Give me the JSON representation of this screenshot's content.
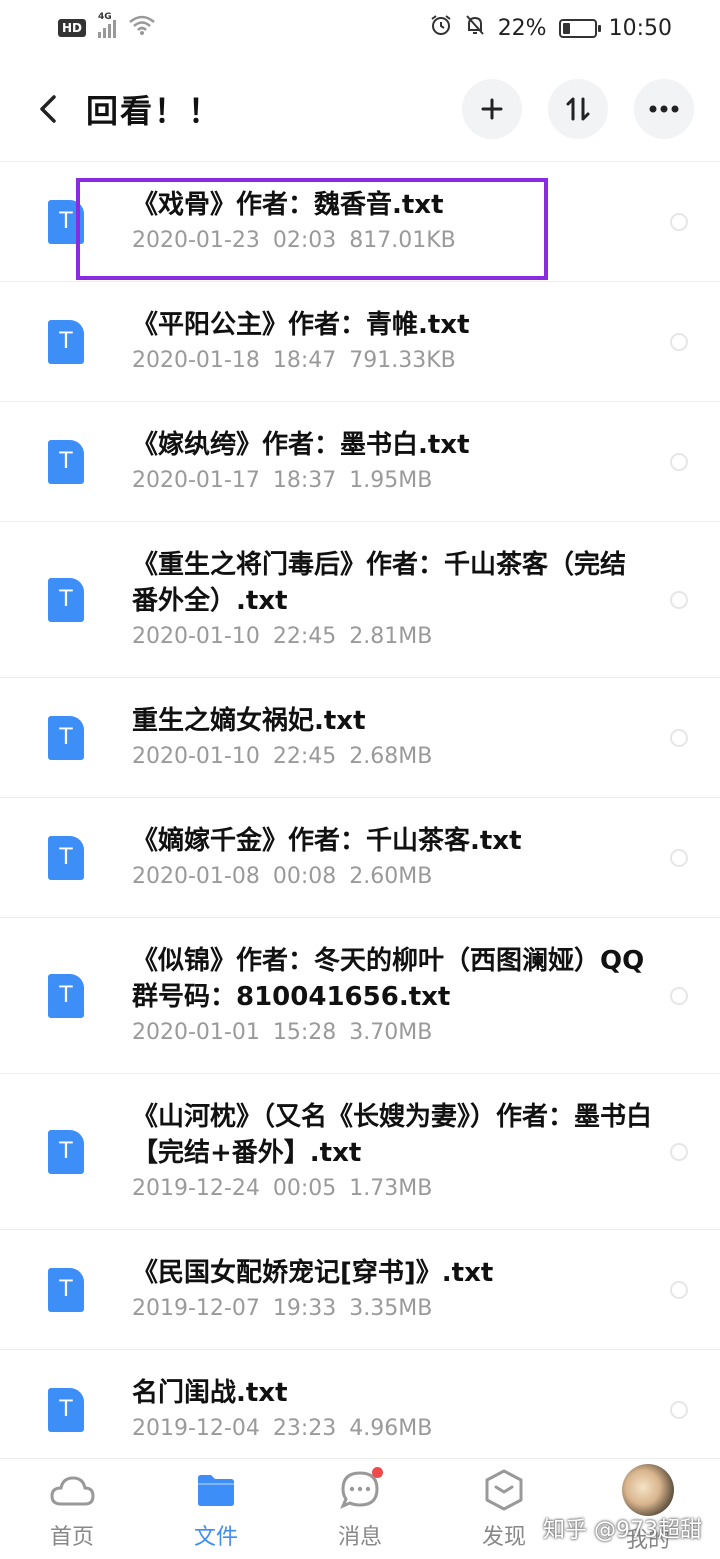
{
  "status_bar": {
    "hd": "HD",
    "network": "4G",
    "battery": "22%",
    "time": "10:50"
  },
  "header": {
    "title": "回看！！"
  },
  "icons": {
    "back": "chevron-left-icon",
    "add": "plus-icon",
    "sort": "sort-icon",
    "more": "more-icon"
  },
  "files": [
    {
      "name": "《戏骨》作者：魏香音.txt",
      "date": "2020-01-23",
      "time": "02:03",
      "size": "817.01KB"
    },
    {
      "name": "《平阳公主》作者：青帷.txt",
      "date": "2020-01-18",
      "time": "18:47",
      "size": "791.33KB"
    },
    {
      "name": "《嫁纨绔》作者：墨书白.txt",
      "date": "2020-01-17",
      "time": "18:37",
      "size": "1.95MB"
    },
    {
      "name": "《重生之将门毒后》作者：千山茶客（完结 番外全）.txt",
      "date": "2020-01-10",
      "time": "22:45",
      "size": "2.81MB"
    },
    {
      "name": "重生之嫡女祸妃.txt",
      "date": "2020-01-10",
      "time": "22:45",
      "size": "2.68MB"
    },
    {
      "name": "《嫡嫁千金》作者：千山茶客.txt",
      "date": "2020-01-08",
      "time": "00:08",
      "size": "2.60MB"
    },
    {
      "name": "《似锦》作者：冬天的柳叶（西图澜娅）QQ群号码：810041656.txt",
      "date": "2020-01-01",
      "time": "15:28",
      "size": "3.70MB"
    },
    {
      "name": "《山河枕》（又名《长嫂为妻》）作者：墨书白【完结+番外】.txt",
      "date": "2019-12-24",
      "time": "00:05",
      "size": "1.73MB"
    },
    {
      "name": "《民国女配娇宠记[穿书]》.txt",
      "date": "2019-12-07",
      "time": "19:33",
      "size": "3.35MB"
    },
    {
      "name": "名门闺战.txt",
      "date": "2019-12-04",
      "time": "23:23",
      "size": "4.96MB"
    }
  ],
  "file_icon_letter": "T",
  "accent_color": "#3d8ef7",
  "highlight_color": "#8a2be2",
  "nav": [
    {
      "label": "首页",
      "icon": "cloud-icon"
    },
    {
      "label": "文件",
      "icon": "folder-icon"
    },
    {
      "label": "消息",
      "icon": "chat-bubble-icon"
    },
    {
      "label": "发现",
      "icon": "discover-hexagon-icon"
    },
    {
      "label": "我的",
      "icon": "avatar"
    }
  ],
  "watermark": "知乎 @973超甜"
}
